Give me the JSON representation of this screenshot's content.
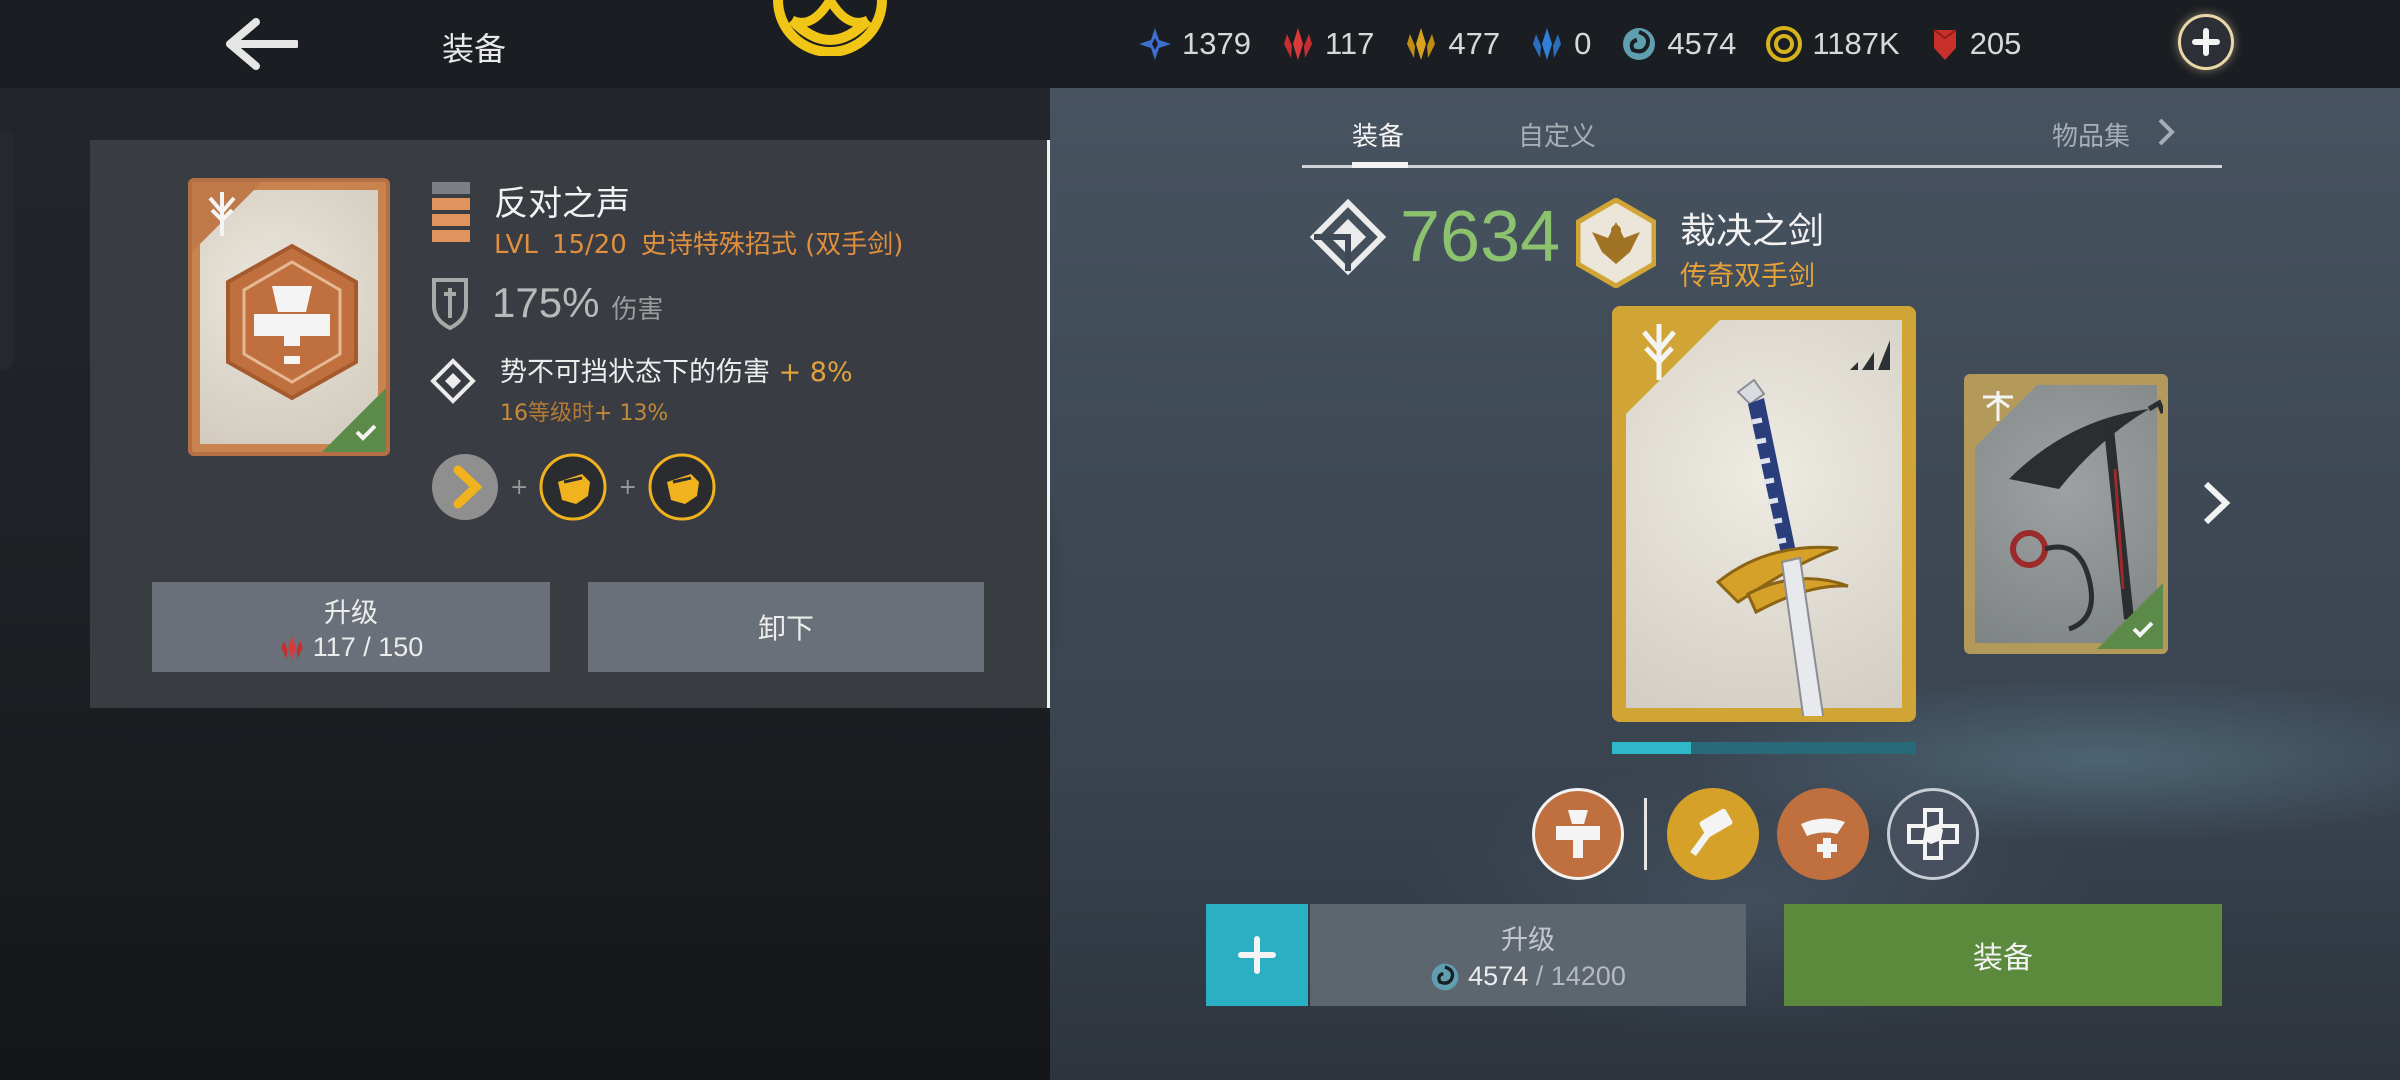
{
  "header": {
    "title": "装备",
    "currencies": [
      {
        "icon": "blue-star-icon",
        "value": "1379",
        "color": "#3e6fd0"
      },
      {
        "icon": "red-crystal-icon",
        "value": "117",
        "color": "#d93a3a"
      },
      {
        "icon": "gold-crystal-icon",
        "value": "477",
        "color": "#d7a21f"
      },
      {
        "icon": "blue-crystal-icon",
        "value": "0",
        "color": "#2f7fd6"
      },
      {
        "icon": "swirl-steel-icon",
        "value": "4574",
        "color": "#5f9fb0"
      },
      {
        "icon": "coin-icon",
        "value": "1187K",
        "color": "#d6b21d"
      },
      {
        "icon": "red-gem-icon",
        "value": "205",
        "color": "#c8302a"
      }
    ]
  },
  "detail": {
    "name": "反对之声",
    "level_prefix": "LVL",
    "level": "15/20",
    "category": "史诗特殊招式 (双手剑)",
    "damage_pct": "175%",
    "damage_label": "伤害",
    "perk_text": "势不可挡状态下的伤害",
    "perk_bonus": "+ 8%",
    "perk_sub_level": "16",
    "perk_sub_text": "等级时",
    "perk_sub_bonus": "+ 13%",
    "combo_plus": "+",
    "upgrade_label": "升级",
    "upgrade_cost": "117 / 150",
    "unequip_label": "卸下"
  },
  "tabs": {
    "equip": "装备",
    "custom": "自定义",
    "collection": "物品集"
  },
  "item": {
    "power": "7634",
    "name": "裁决之剑",
    "type": "传奇双手剑",
    "progress": 0.26
  },
  "actions": {
    "upgrade_label": "升级",
    "upgrade_current": "4574",
    "upgrade_sep": " / ",
    "upgrade_max": "14200",
    "equip_label": "装备"
  }
}
